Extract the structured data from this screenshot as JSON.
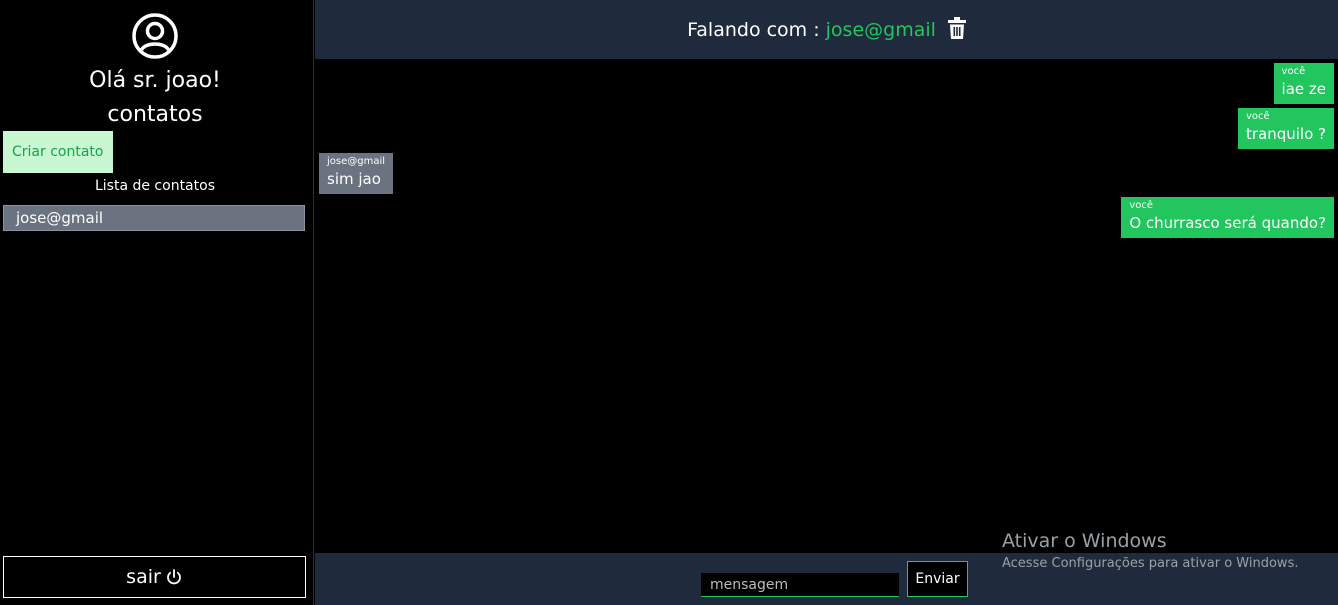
{
  "sidebar": {
    "avatar_icon": "user-circle-icon",
    "greeting": "Olá sr. joao!",
    "contacts_heading": "contatos",
    "create_contact_label": "Criar contato",
    "list_title": "Lista de contatos",
    "contacts": [
      "jose@gmail"
    ],
    "logout_label": "sair",
    "logout_icon": "power-icon"
  },
  "header": {
    "prefix": "Falando com :",
    "contact_name": "jose@gmail",
    "delete_icon": "trash-icon",
    "accent_color": "#22c55e"
  },
  "messages": [
    {
      "sender": "você",
      "text": "iae ze",
      "mine": true
    },
    {
      "sender": "você",
      "text": "tranquilo ?",
      "mine": true
    },
    {
      "sender": "jose@gmail",
      "text": "sim jao",
      "mine": false
    },
    {
      "sender": "você",
      "text": "O churrasco será quando?",
      "mine": true
    }
  ],
  "composer": {
    "placeholder": "mensagem",
    "send_label": "Enviar"
  },
  "watermark": {
    "title": "Ativar o Windows",
    "subtitle": "Acesse Configurações para ativar o Windows."
  },
  "colors": {
    "header_bg": "#1f2a3c",
    "mine_bubble": "#22c55e",
    "their_bubble": "#6b7280",
    "create_button_bg": "#c8f7d2"
  }
}
